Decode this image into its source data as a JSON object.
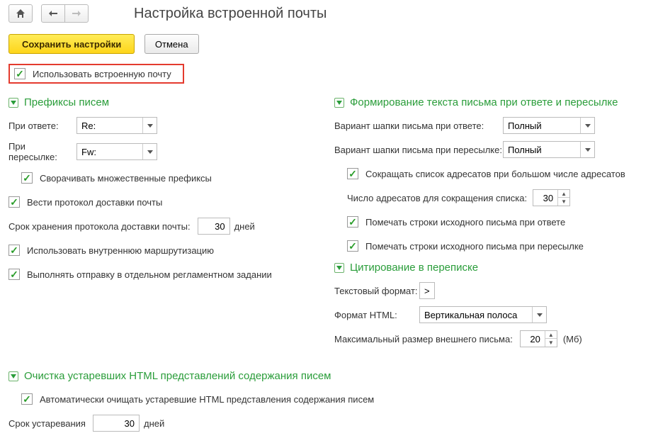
{
  "header": {
    "title": "Настройка встроенной почты"
  },
  "actions": {
    "save": "Сохранить настройки",
    "cancel": "Отмена"
  },
  "use_builtin_mail": {
    "label": "Использовать встроенную почту"
  },
  "prefixes": {
    "title": "Префиксы писем",
    "reply_label": "При ответе:",
    "reply_value": "Re:",
    "forward_label": "При пересылке:",
    "forward_value": "Fw:",
    "collapse_label": "Сворачивать множественные префиксы",
    "protocol_label": "Вести протокол доставки почты",
    "retention_label": "Срок хранения протокола доставки почты:",
    "retention_value": "30",
    "retention_unit": "дней",
    "routing_label": "Использовать внутреннюю маршрутизацию",
    "separate_job_label": "Выполнять отправку в отдельном регламентном задании"
  },
  "reply": {
    "title": "Формирование текста письма при ответе и пересылке",
    "header_reply_label": "Вариант шапки письма при ответе:",
    "header_reply_value": "Полный",
    "header_forward_label": "Вариант шапки письма при пересылке:",
    "header_forward_value": "Полный",
    "shorten_label": "Сокращать список адресатов при большом числе адресатов",
    "count_label": "Число адресатов для сокращения списка:",
    "count_value": "30",
    "mark_reply_label": "Помечать строки исходного письма при ответе",
    "mark_forward_label": "Помечать строки исходного письма при пересылке"
  },
  "quote": {
    "title": "Цитирование в переписке",
    "text_label": "Текстовый формат:",
    "text_value": ">",
    "html_label": "Формат HTML:",
    "html_value": "Вертикальная полоса",
    "maxsize_label": "Максимальный размер внешнего письма:",
    "maxsize_value": "20",
    "maxsize_unit": "(Мб)"
  },
  "cleanup": {
    "title": "Очистка устаревших HTML представлений содержания писем",
    "auto_label": "Автоматически очищать устаревшие HTML представления содержания писем",
    "age_label": "Срок устаревания",
    "age_value": "30",
    "age_unit": "дней"
  }
}
